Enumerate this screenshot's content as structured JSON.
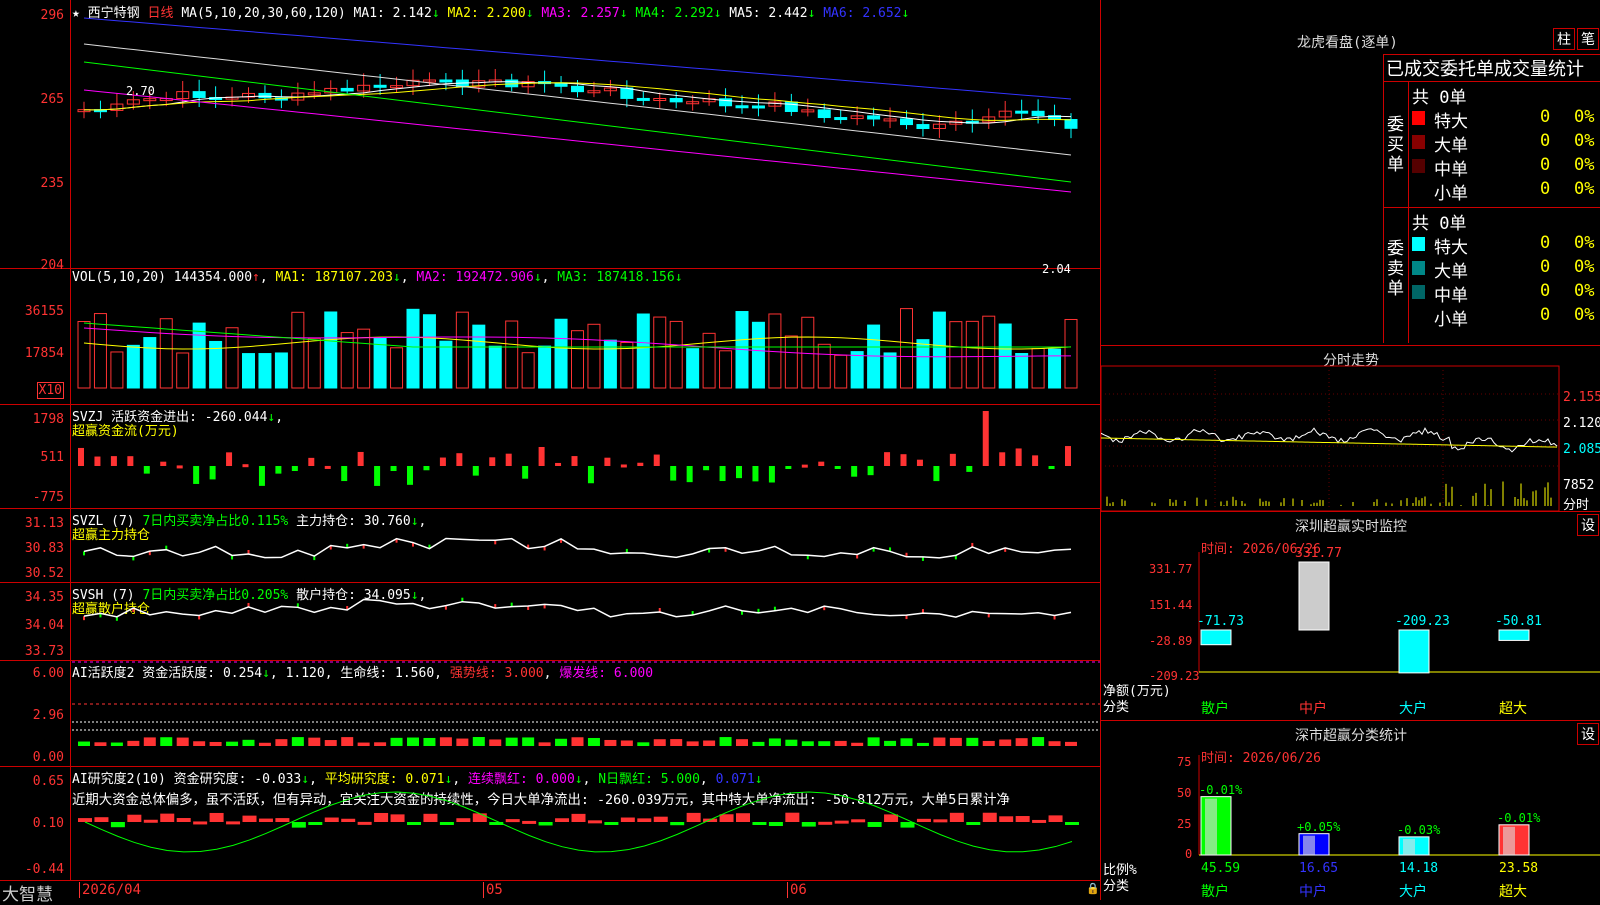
{
  "main": {
    "header": {
      "stock": "西宁特钢",
      "period": "日线",
      "ma_label": "MA(5,10,20,30,60,120)",
      "ma1": "MA1: 2.142",
      "ma2": "MA2: 2.200",
      "ma3": "MA3: 2.257",
      "ma4": "MA4: 2.292",
      "ma5": "MA5: 2.442",
      "ma6": "MA6: 2.652"
    },
    "yticks": [
      "296",
      "265",
      "235",
      "204"
    ],
    "high_label": "2.70",
    "low_label": "2.04"
  },
  "vol": {
    "header": "VOL(5,10,20)",
    "value": "144354.000",
    "ma1": "MA1: 187107.203",
    "ma2": "MA2: 192472.906",
    "ma3": "MA3: 187418.156",
    "yticks": [
      "36155",
      "17854"
    ],
    "unit": "X10"
  },
  "svzj": {
    "header": "SVZJ  活跃资金进出: -260.044",
    "sub": "超赢资金流(万元)",
    "yticks": [
      "1798",
      "511",
      "-775"
    ]
  },
  "svzl": {
    "header": "SVZL (7)",
    "pct": "7日内买卖净占比0.115%",
    "hold": "主力持仓: 30.760",
    "sub": "超赢主力持仓",
    "yticks": [
      "31.13",
      "30.83",
      "30.52"
    ]
  },
  "svsh": {
    "header": "SVSH (7)",
    "pct": "7日内买卖净占比0.205%",
    "hold": "散户持仓: 34.095",
    "sub": "超赢散户持仓",
    "yticks": [
      "34.35",
      "34.04",
      "33.73"
    ]
  },
  "ai1": {
    "header": "AI活跃度2 资金活跃度: 0.254",
    "v2": "1.120",
    "life": "生命线: 1.560",
    "strong": "强势线: 3.000",
    "burst": "爆发线: 6.000",
    "yticks": [
      "6.00",
      "2.96",
      "0.00"
    ]
  },
  "ai2": {
    "header": "AI研究度2(10) 资金研究度: -0.033",
    "avg": "平均研究度: 0.071",
    "red": "连续飘红: 0.000",
    "n": "N日飘红: 5.000",
    "last": "0.071",
    "comment": "近期大资金总体偏多，虽不活跃，但有异动，宜关注大资金的持续性，今日大单净流出: -260.039万元，其中特大单净流出: -50.812万元，大单5日累计净",
    "yticks": [
      "0.65",
      "0.10",
      "-0.44"
    ]
  },
  "xaxis": {
    "brand": "大智慧",
    "date": "2026/04",
    "m5": "05",
    "m6": "06"
  },
  "lhb": {
    "title": "龙虎看盘(逐单)",
    "btn1": "柱",
    "btn2": "笔",
    "subtitle": "已成交委托单成交量统计",
    "buy": {
      "label": "委买单",
      "total": "共 0单",
      "rows": [
        {
          "name": "特大",
          "n": "0",
          "p": "0%"
        },
        {
          "name": "大单",
          "n": "0",
          "p": "0%"
        },
        {
          "name": "中单",
          "n": "0",
          "p": "0%"
        },
        {
          "name": "小单",
          "n": "0",
          "p": "0%"
        }
      ]
    },
    "sell": {
      "label": "委卖单",
      "total": "共 0单",
      "rows": [
        {
          "name": "特大",
          "n": "0",
          "p": "0%"
        },
        {
          "name": "大单",
          "n": "0",
          "p": "0%"
        },
        {
          "name": "中单",
          "n": "0",
          "p": "0%"
        },
        {
          "name": "小单",
          "n": "0",
          "p": "0%"
        }
      ]
    }
  },
  "fenshi": {
    "title": "分时走势",
    "p1": "2.155",
    "p2": "2.120",
    "p3": "2.085",
    "vol": "7852",
    "tag": "分时"
  },
  "monitor": {
    "title": "深圳超赢实时监控",
    "btn": "设",
    "date": "时间: 2026/06/26",
    "yticks": [
      "331.77",
      "151.44",
      "-28.89",
      "-209.23"
    ],
    "ylabel": "净额(万元)",
    "xlabel": "分类",
    "bars": [
      {
        "name": "散户",
        "val": "-71.73"
      },
      {
        "name": "中户",
        "val": "331.77"
      },
      {
        "name": "大户",
        "val": "-209.23"
      },
      {
        "name": "超大",
        "val": "-50.81"
      }
    ]
  },
  "classify": {
    "title": "深市超赢分类统计",
    "btn": "设",
    "date": "时间: 2026/06/26",
    "yticks": [
      "75",
      "50",
      "25",
      "0"
    ],
    "ylabel": "比例%",
    "xlabel": "分类",
    "bars": [
      {
        "name": "散户",
        "top": "-0.01%",
        "val": "45.59"
      },
      {
        "name": "中户",
        "top": "+0.05%",
        "val": "16.65"
      },
      {
        "name": "大户",
        "top": "-0.03%",
        "val": "14.18"
      },
      {
        "name": "超大",
        "top": "-0.01%",
        "val": "23.58"
      }
    ]
  },
  "colors": {
    "up": "#ff3333",
    "down": "#00ffff",
    "grid": "#cc0000"
  }
}
